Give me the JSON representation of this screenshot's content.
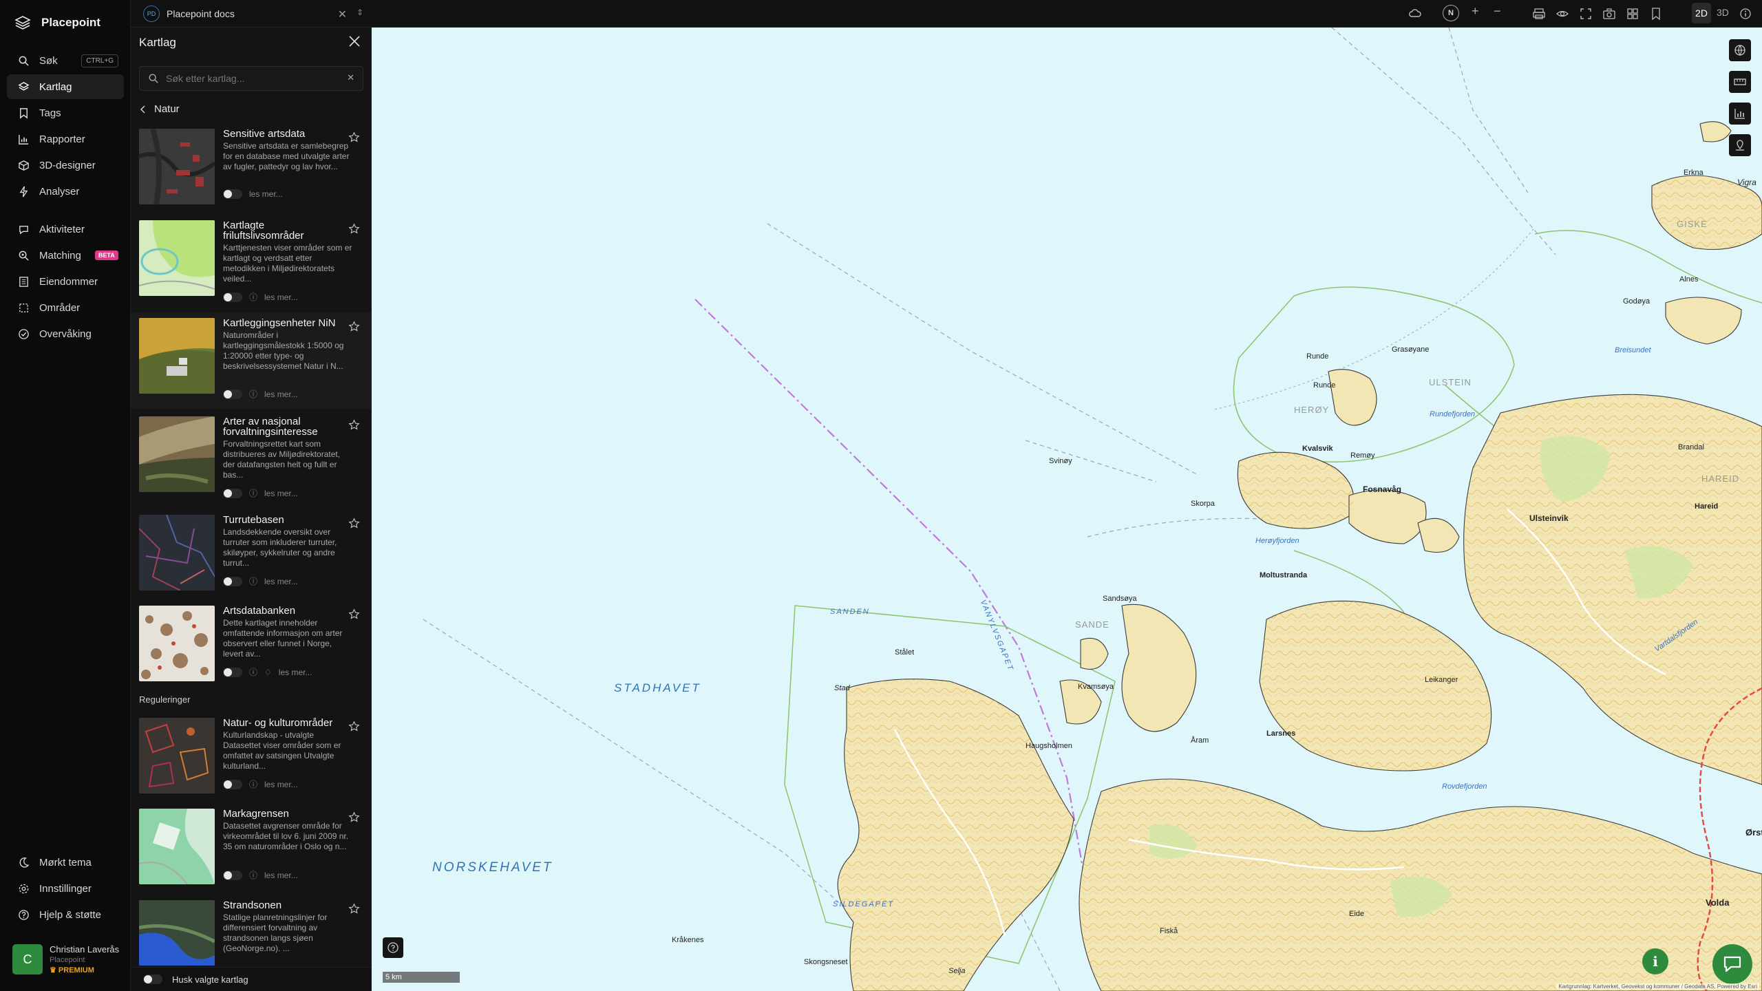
{
  "brand": {
    "name": "Placepoint"
  },
  "nav": {
    "items": [
      {
        "label": "Søk",
        "shortcut": "CTRL+G"
      },
      {
        "label": "Kartlag"
      },
      {
        "label": "Tags"
      },
      {
        "label": "Rapporter"
      },
      {
        "label": "3D-designer"
      },
      {
        "label": "Analyser"
      },
      {
        "label": "Aktiviteter"
      },
      {
        "label": "Matching",
        "badge": "BETA"
      },
      {
        "label": "Eiendommer"
      },
      {
        "label": "Områder"
      },
      {
        "label": "Overvåking"
      }
    ],
    "bottom": [
      {
        "label": "Mørkt tema"
      },
      {
        "label": "Innstillinger"
      },
      {
        "label": "Hjelp & støtte"
      }
    ],
    "user": {
      "initial": "C",
      "name": "Christian Laverås",
      "org": "Placepoint",
      "tier": "PREMIUM"
    }
  },
  "tab": {
    "badge": "PD",
    "title": "Placepoint docs"
  },
  "panel": {
    "title": "Kartlag",
    "search_placeholder": "Søk etter kartlag...",
    "breadcrumb": "Natur",
    "section_regulations": "Reguleringer",
    "more_label": "les mer...",
    "remember_label": "Husk valgte kartlag",
    "layers": [
      {
        "title": "Sensitive artsdata",
        "desc": "Sensitive artsdata er samlebegrep for en database med utvalgte arter av fugler, pattedyr og lav hvor..."
      },
      {
        "title": "Kartlagte friluftslivsområder",
        "desc": "Karttjenesten viser områder som er kartlagt og verdsatt etter metodikken i Miljødirektoratets veiled..."
      },
      {
        "title": "Kartleggingsenheter NiN",
        "desc": "Naturområder i kartleggingsmålestokk 1:5000 og 1:20000 etter type- og beskrivelsessystemet Natur i N..."
      },
      {
        "title": "Arter av nasjonal forvaltningsinteresse",
        "desc": "Forvaltningsrettet kart som distribueres av Miljødirektoratet, der datafangsten helt og fullt er bas..."
      },
      {
        "title": "Turrutebasen",
        "desc": "Landsdekkende oversikt over turruter som inkluderer turruter, skiløyper, sykkelruter og andre turrut..."
      },
      {
        "title": "Artsdatabanken",
        "desc": "Dette kartlaget inneholder omfattende informasjon om arter observert eller funnet i Norge, levert av..."
      },
      {
        "title": "Natur- og kulturområder",
        "desc": "Kulturlandskap - utvalgte Datasettet viser områder som er omfattet av satsingen Utvalgte kulturland..."
      },
      {
        "title": "Markagrensen",
        "desc": "Datasettet avgrenser område for virkeområdet til lov 6. juni 2009 nr. 35 om naturområder i Oslo og n..."
      },
      {
        "title": "Strandsonen",
        "desc": "Statlige planretningslinjer for differensiert forvaltning av strandsonen langs sjøen (GeoNorge.no). ..."
      }
    ]
  },
  "toolbar": {
    "compass": "N",
    "zoom_in": "+",
    "zoom_out": "−",
    "mode_2d": "2D",
    "mode_3d": "3D"
  },
  "map": {
    "scale": "5 km",
    "attribution": "Kartgrunnlag: Kartverket, Geovekst og kommuner / Geodata AS, Powered by Esri",
    "labels": {
      "stadhavet": "STADHAVET",
      "norskehavet": "NORSKEHAVET",
      "sanden": "SANDEN",
      "sande": "SANDE",
      "vanylvsgapet": "VANYLVSGAPET",
      "sildegapet": "SILDEGAPET",
      "heroy": "HERØY",
      "ulstein": "ULSTEIN",
      "giske": "GISKE",
      "hareid": "HAREID",
      "breisundet": "Breisundet",
      "runde": "Runde",
      "runde2": "Runde",
      "grasoyane": "Grasøyane",
      "kvalsvik": "Kvalsvik",
      "fosnavag": "Fosnavåg",
      "remoy": "Remøy",
      "ulsteinvik": "Ulsteinvik",
      "hareid_town": "Hareid",
      "brandal": "Brandal",
      "moltustranda": "Moltustranda",
      "larsnes": "Larsnes",
      "aram": "Åram",
      "fiskaa": "Fiskå",
      "eide": "Eide",
      "volda": "Volda",
      "orsta": "Ørsta",
      "vartdalsfjorden": "Vartdalsfjorden",
      "rovdefjorden": "Rovdefjorden",
      "heroyfjorden": "Herøyfjorden",
      "rundefjorden": "Rundefjorden",
      "stalet": "Stålet",
      "stad": "Stad",
      "kraakenes": "Kråkenes",
      "skongsneset": "Skongsneset",
      "selja": "Selja",
      "erkna": "Erkna",
      "vigra": "Vigra",
      "alnes": "Alnes",
      "godoya": "Godøya",
      "svinoy": "Svinøy",
      "skorpa": "Skorpa",
      "sandsoya": "Sandsøya",
      "kvamsoya": "Kvamsøya",
      "leikanger": "Leikanger",
      "haugsholmen": "Haugsholmen"
    }
  },
  "colors": {
    "accent": "#2e8b3e",
    "sea": "#dff6fb",
    "land": "#f3e6b5",
    "contour": "#d9a33a",
    "boundary": "#8ac56b",
    "route": "#c079d8"
  }
}
